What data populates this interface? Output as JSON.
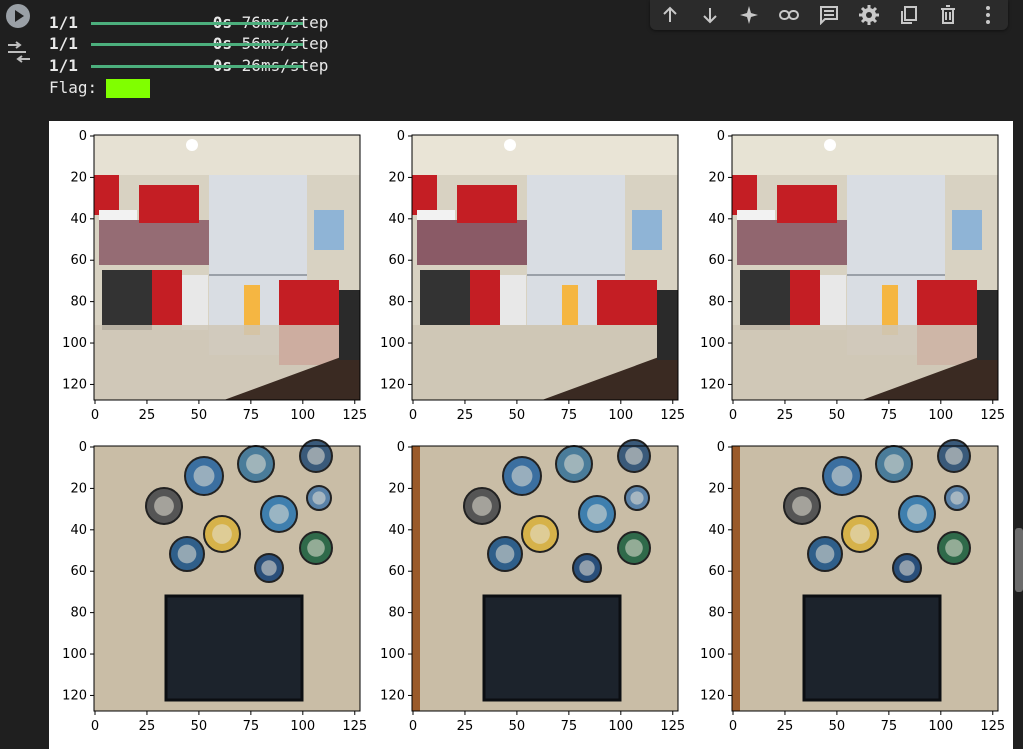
{
  "output_lines": [
    {
      "progress": "1/1",
      "time": "0s",
      "rate": "76ms/step",
      "fraction": 1.0
    },
    {
      "progress": "1/1",
      "time": "0s",
      "rate": "56ms/step",
      "fraction": 1.0
    },
    {
      "progress": "1/1",
      "time": "0s",
      "rate": "26ms/step",
      "fraction": 1.0
    }
  ],
  "flag": {
    "label": "Flag:",
    "color": "#80ff00"
  },
  "toolbar": {
    "icons": [
      "arrow-up-icon",
      "arrow-down-icon",
      "sparkle-icon",
      "link-icon",
      "comment-icon",
      "settings-gear-icon",
      "mirror-cell-icon",
      "delete-trash-icon",
      "more-vert-icon"
    ]
  },
  "figure": {
    "rows": 2,
    "cols": 3,
    "x_ticks": [
      "0",
      "25",
      "50",
      "75",
      "100",
      "125"
    ],
    "y_ticks": [
      "0",
      "20",
      "40",
      "60",
      "80",
      "100",
      "120"
    ],
    "panels": [
      {
        "scene": "kitchen",
        "variant": "blurred"
      },
      {
        "scene": "kitchen",
        "variant": "sharp"
      },
      {
        "scene": "kitchen",
        "variant": "reconstructed"
      },
      {
        "scene": "wall-plates-tv",
        "variant": "blurred"
      },
      {
        "scene": "wall-plates-tv",
        "variant": "sharp"
      },
      {
        "scene": "wall-plates-tv",
        "variant": "reconstructed"
      }
    ]
  },
  "colors": {
    "progress_bar": "#4caf7d",
    "kitchen_red": "#c41e24",
    "wall_beige": "#c9bda6",
    "tv_dark": "#1c232c"
  }
}
